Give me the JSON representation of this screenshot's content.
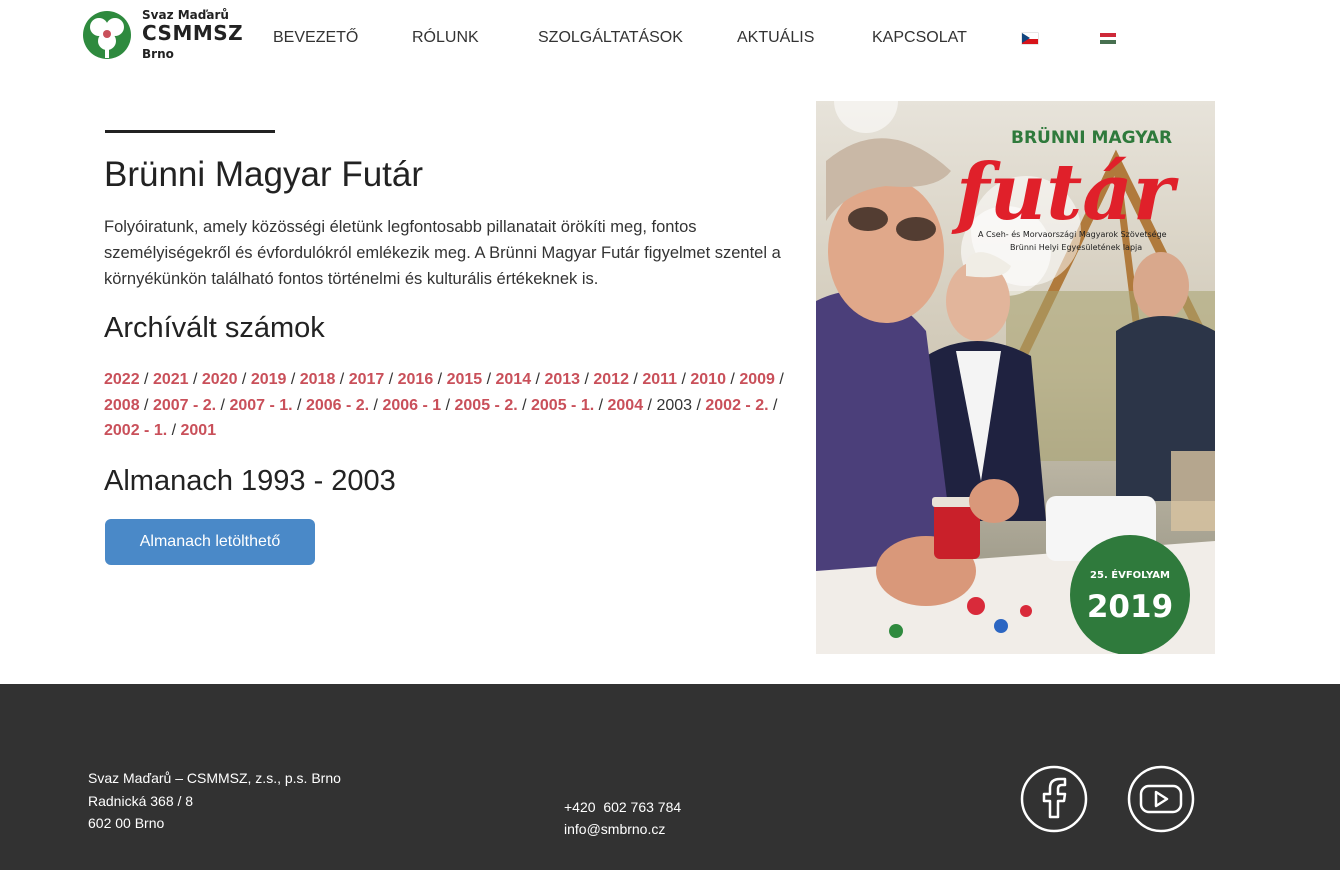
{
  "header": {
    "logo": {
      "line1": "Svaz Maďarů",
      "line2": "CSMMSZ",
      "line3": "Brno"
    },
    "nav": [
      {
        "label": "BEVEZETŐ"
      },
      {
        "label": "RÓLUNK"
      },
      {
        "label": "SZOLGÁLTATÁSOK"
      },
      {
        "label": "AKTUÁLIS"
      },
      {
        "label": "KAPCSOLAT"
      }
    ],
    "flags": [
      "czech-flag-icon",
      "hungarian-flag-icon"
    ]
  },
  "main": {
    "title": "Brünni Magyar Futár",
    "intro": "Folyóiratunk, amely közösségi életünk legfontosabb pillanatait örökíti meg, fontos személyiségekről és évfordulókról emlékezik meg. A Brünni Magyar Futár figyelmet szentel a környékünkön található fontos történelmi és kulturális értékeknek is.",
    "archive_heading": "Archívált számok",
    "archive": [
      {
        "label": "2022",
        "link": true
      },
      {
        "label": "2021",
        "link": true
      },
      {
        "label": "2020",
        "link": true
      },
      {
        "label": "2019",
        "link": true
      },
      {
        "label": "2018",
        "link": true
      },
      {
        "label": "2017",
        "link": true
      },
      {
        "label": "2016",
        "link": true
      },
      {
        "label": "2015",
        "link": true
      },
      {
        "label": "2014",
        "link": true
      },
      {
        "label": "2013",
        "link": true
      },
      {
        "label": "2012",
        "link": true
      },
      {
        "label": "2011",
        "link": true
      },
      {
        "label": "2010",
        "link": true
      },
      {
        "label": "2009",
        "link": true
      },
      {
        "label": "2008",
        "link": true
      },
      {
        "label": "2007 - 2.",
        "link": true
      },
      {
        "label": "2007 - 1.",
        "link": true
      },
      {
        "label": "2006 - 2.",
        "link": true
      },
      {
        "label": "2006 - 1",
        "link": true
      },
      {
        "label": "2005 - 2.",
        "link": true
      },
      {
        "label": "2005 - 1.",
        "link": true
      },
      {
        "label": "2004",
        "link": true
      },
      {
        "label": "2003",
        "link": false
      },
      {
        "label": "2002 - 2.",
        "link": true
      },
      {
        "label": "2002 - 1.",
        "link": true
      },
      {
        "label": "2001",
        "link": true
      }
    ],
    "almanach_heading": "Almanach 1993 - 2003",
    "almanach_button": "Almanach letölthető"
  },
  "cover": {
    "top_title": "BRÜNNI MAGYAR",
    "big_title": "futár",
    "sub1": "A Cseh- és Morvaországi Magyarok Szövetsége",
    "sub2": "Brünni Helyi Egyesületének lapja",
    "volume": "25. ÉVFOLYAM",
    "year": "2019"
  },
  "footer": {
    "address": [
      "Svaz Maďarů – CSMMSZ, z.s., p.s. Brno",
      "Radnická 368 / 8",
      "602 00 Brno"
    ],
    "phone": "+420  602 763 784",
    "email": "info@smbrno.cz",
    "social": [
      "facebook-icon",
      "youtube-icon"
    ]
  },
  "colors": {
    "link": "#c9505a",
    "button": "#4a89c8",
    "footer_bg": "#323232",
    "cover_red": "#e0202a",
    "cover_green": "#2f7a3c"
  }
}
